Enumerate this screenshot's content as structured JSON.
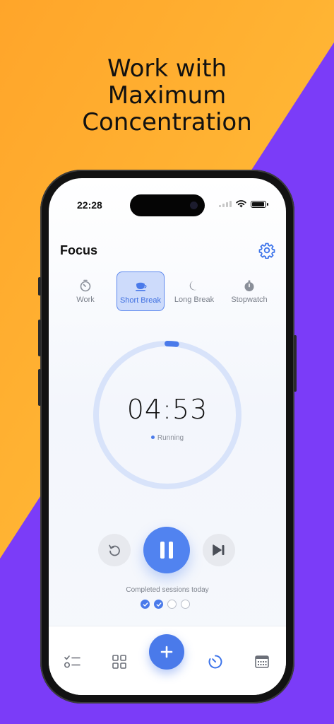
{
  "headline": {
    "line1": "Work with",
    "line2": "Maximum",
    "line3": "Concentration"
  },
  "status_bar": {
    "time": "22:28"
  },
  "header": {
    "title": "Focus",
    "settings_icon": "gear-icon"
  },
  "modes": [
    {
      "label": "Work",
      "icon": "timer-icon",
      "active": false
    },
    {
      "label": "Short Break",
      "icon": "coffee-cup-icon",
      "active": true
    },
    {
      "label": "Long Break",
      "icon": "moon-icon",
      "active": false
    },
    {
      "label": "Stopwatch",
      "icon": "stopwatch-icon",
      "active": false
    }
  ],
  "timer": {
    "time": "04:53",
    "status": "Running",
    "progress": 0.02
  },
  "controls": {
    "reset_icon": "restart-icon",
    "pause_icon": "pause-icon",
    "skip_icon": "skip-forward-icon"
  },
  "sessions": {
    "label": "Completed sessions today",
    "completed": 2,
    "total": 4
  },
  "tabbar": {
    "items": [
      "checklist-icon",
      "grid-icon",
      "plus-icon",
      "timer-icon",
      "calendar-icon"
    ],
    "active": "timer-icon"
  },
  "colors": {
    "accent": "#4A7AEA",
    "bg_orange": "#FFAA2B",
    "bg_purple": "#7B3CF8",
    "ring_track": "#D8E3FA"
  }
}
